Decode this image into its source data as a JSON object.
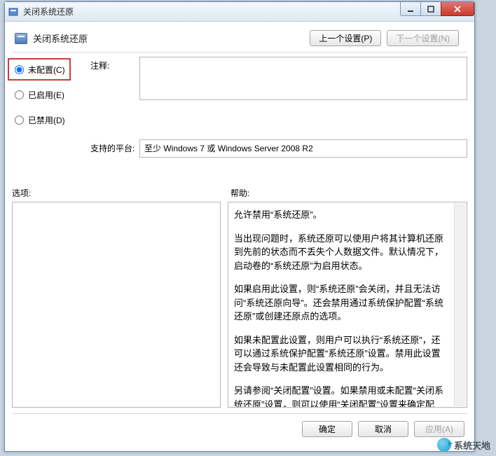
{
  "window": {
    "title": "关闭系统还原"
  },
  "header": {
    "title": "关闭系统还原",
    "prev_btn": "上一个设置(P)",
    "next_btn": "下一个设置(N)"
  },
  "radios": {
    "not_configured": "未配置(C)",
    "enabled": "已启用(E)",
    "disabled": "已禁用(D)",
    "selected": "not_configured"
  },
  "labels": {
    "comment": "注释:",
    "platform": "支持的平台:",
    "options": "选项:",
    "help": "帮助:"
  },
  "platform_text": "至少 Windows 7 或 Windows Server 2008 R2",
  "help_paragraphs": [
    "允许禁用“系统还原”。",
    "当出现问题时，系统还原可以使用户将其计算机还原到先前的状态而不丢失个人数据文件。默认情况下，启动卷的“系统还原”为启用状态。",
    "如果启用此设置，则“系统还原”会关闭，并且无法访问“系统还原向导”。还会禁用通过系统保护配置“系统还原”或创建还原点的选项。",
    "如果未配置此设置，则用户可以执行“系统还原”，还可以通过系统保护配置“系统还原”设置。禁用此设置还会导致与未配置此设置相同的行为。",
    "另请参阅“关闭配置”设置。如果禁用或未配置“关闭系统还原”设置，则可以使用“关闭配置”设置来确定配置“系统还原”的选项是否可用。"
  ],
  "footer": {
    "ok": "确定",
    "cancel": "取消",
    "apply": "应用(A)"
  },
  "watermark": "系统天地"
}
